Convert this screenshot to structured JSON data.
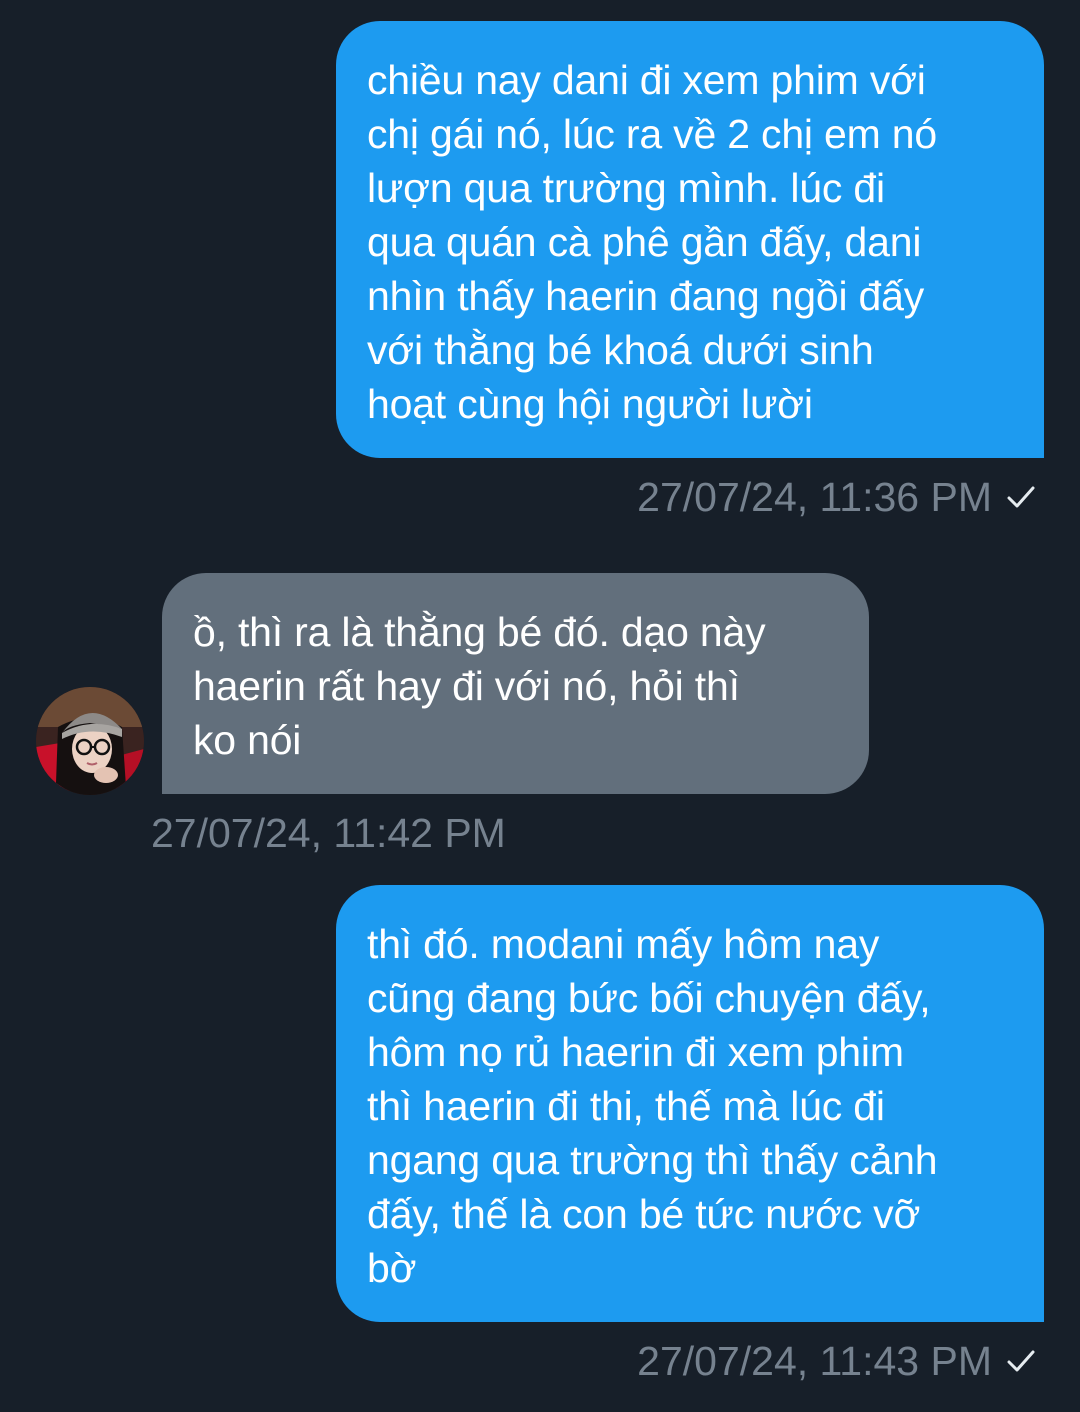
{
  "messages": [
    {
      "direction": "sent",
      "text": "chiều nay dani đi xem phim với\nchị gái nó, lúc ra về 2 chị em nó\nlượn qua trường mình. lúc đi\nqua quán cà phê gần đấy, dani\nnhìn thấy haerin đang ngồi đấy\nvới thằng bé khoá dưới sinh\nhoạt cùng hội người lười",
      "timestamp": "27/07/24, 11:36 PM",
      "status_icon": "checkmark-icon"
    },
    {
      "direction": "received",
      "text": "ồ, thì ra là thằng bé đó. dạo này\nhaerin rất hay đi với nó, hỏi thì\nko nói",
      "timestamp": "27/07/24, 11:42 PM",
      "avatar_icon": "avatar"
    },
    {
      "direction": "sent",
      "text": "thì đó. modani mấy hôm nay\ncũng đang bức bối chuyện đấy,\nhôm nọ rủ haerin đi xem phim\nthì haerin đi thi, thế mà lúc đi\nngang qua trường thì thấy cảnh\nđấy, thế là con bé tức nước vỡ\nbờ",
      "timestamp": "27/07/24, 11:43 PM",
      "status_icon": "checkmark-icon"
    }
  ],
  "colors": {
    "background": "#171f29",
    "sent_bubble": "#1d9bf0",
    "received_bubble": "#626f7c",
    "timestamp": "#76828f"
  }
}
